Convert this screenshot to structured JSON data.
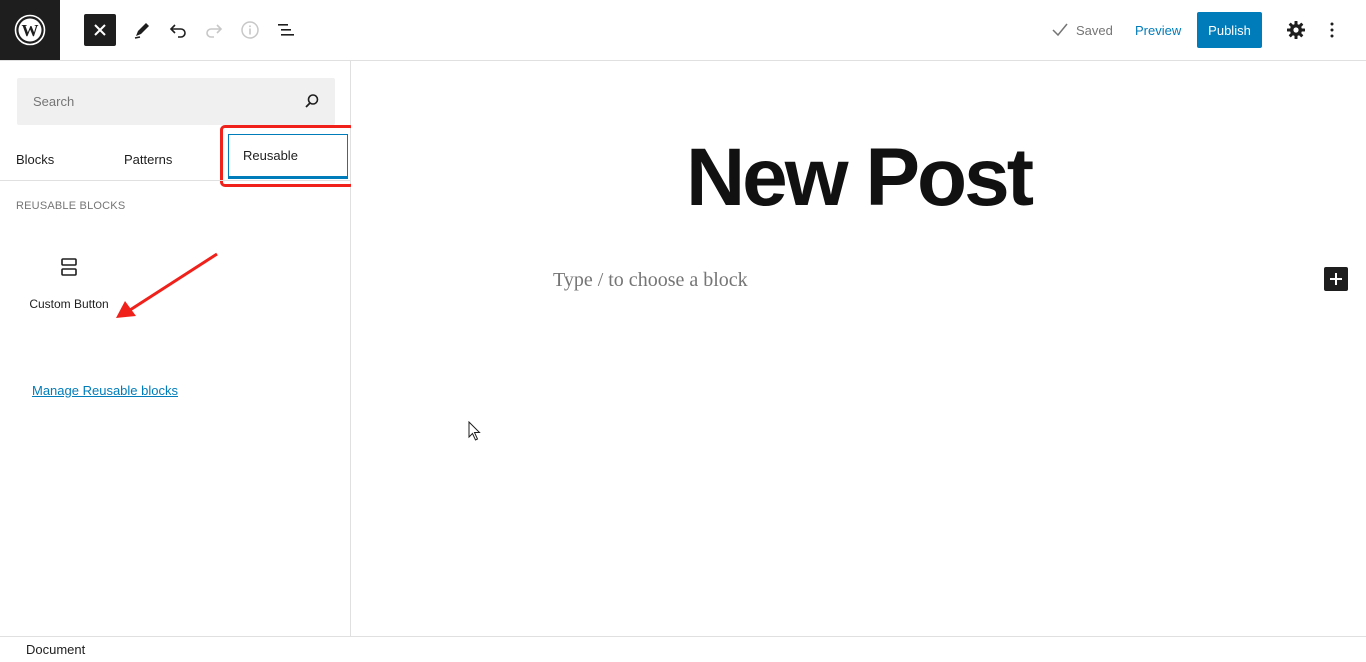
{
  "toolbar": {
    "saved_label": "Saved",
    "preview_label": "Preview",
    "publish_label": "Publish"
  },
  "sidebar": {
    "search_placeholder": "Search",
    "tabs": [
      {
        "label": "Blocks"
      },
      {
        "label": "Patterns"
      },
      {
        "label": "Reusable",
        "active": true
      }
    ],
    "section_title": "REUSABLE BLOCKS",
    "blocks": [
      {
        "label": "Custom Button",
        "icon": "reusable-block-icon"
      }
    ],
    "manage_link": "Manage Reusable blocks"
  },
  "canvas": {
    "post_title": "New Post",
    "block_placeholder": "Type / to choose a block"
  },
  "footer": {
    "breadcrumb": "Document"
  },
  "colors": {
    "accent": "#007cba",
    "highlight": "#f0211b",
    "dark": "#1e1e1e"
  }
}
